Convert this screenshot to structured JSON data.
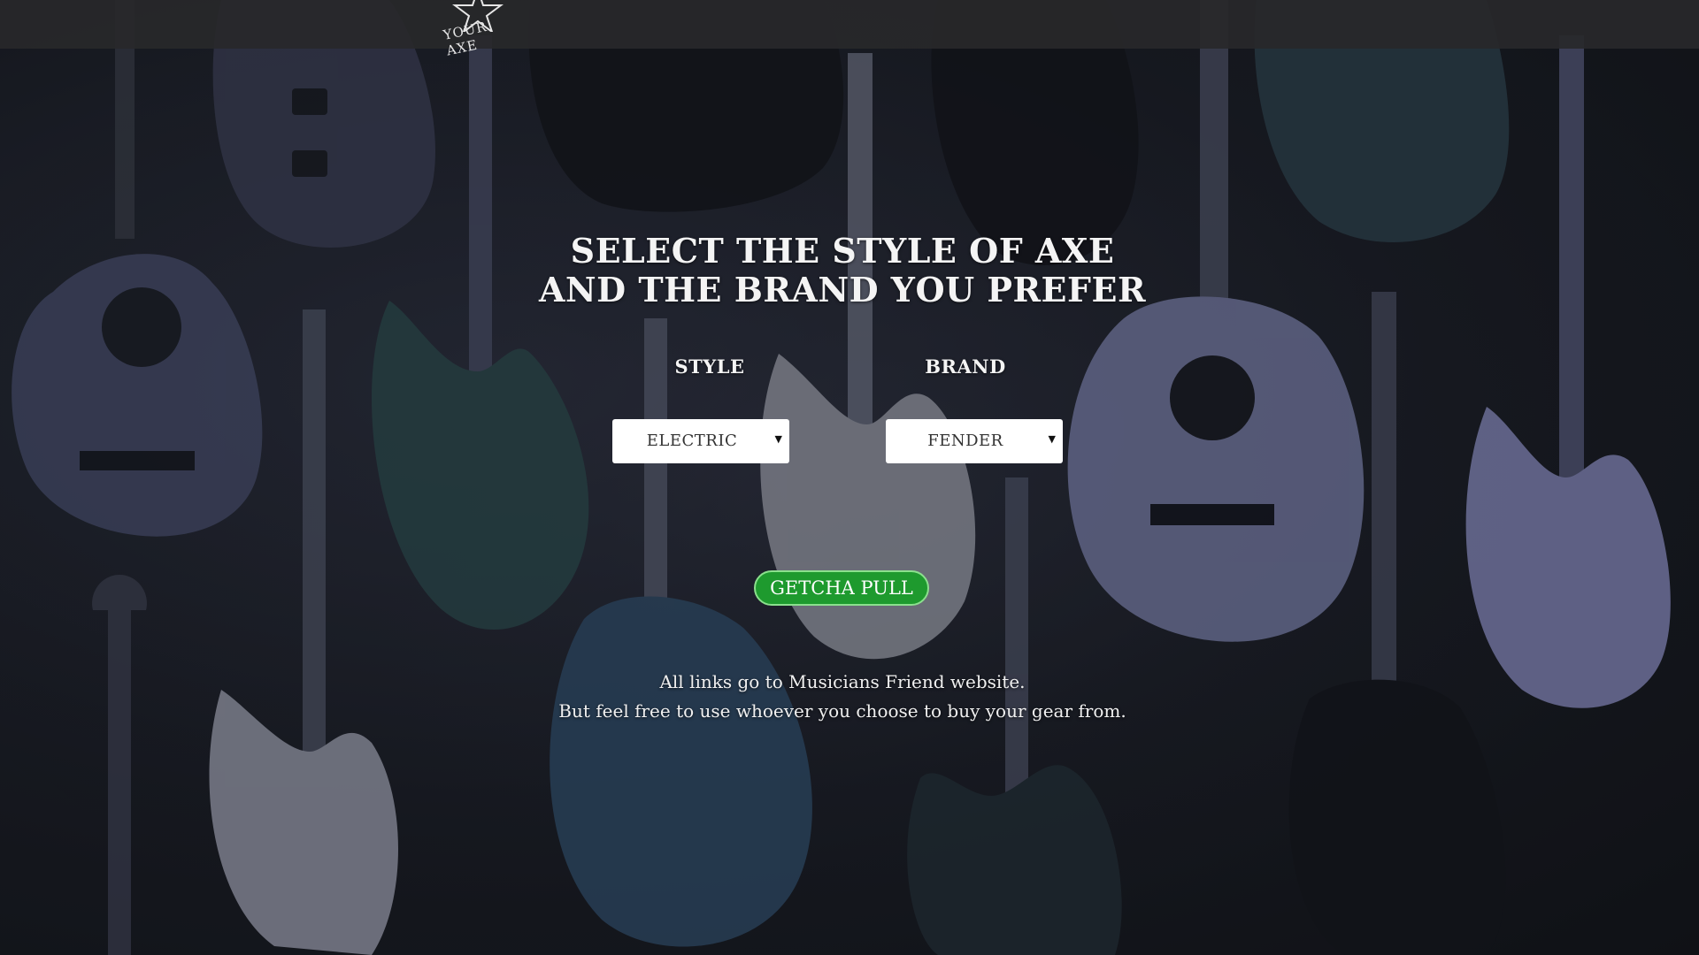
{
  "header": {
    "logo_text": "YOUR AXE"
  },
  "main": {
    "headline_line1": "SELECT THE STYLE OF AXE",
    "headline_line2": "AND THE BRAND YOU PREFER",
    "style": {
      "label": "STYLE",
      "selected": "ELECTRIC"
    },
    "brand": {
      "label": "BRAND",
      "selected": "FENDER"
    },
    "cta_label": "GETCHA PULL",
    "note_line1": "All links go to Musicians Friend website.",
    "note_line2": "But feel free to use whoever you choose to buy your gear from."
  },
  "colors": {
    "cta_background": "#1e9a2e",
    "cta_border": "#8be08d",
    "topbar": "#28282a",
    "text": "#f4f4f4"
  },
  "icons": {
    "select_caret": "caret-down-icon",
    "logo": "star-logo-icon"
  }
}
